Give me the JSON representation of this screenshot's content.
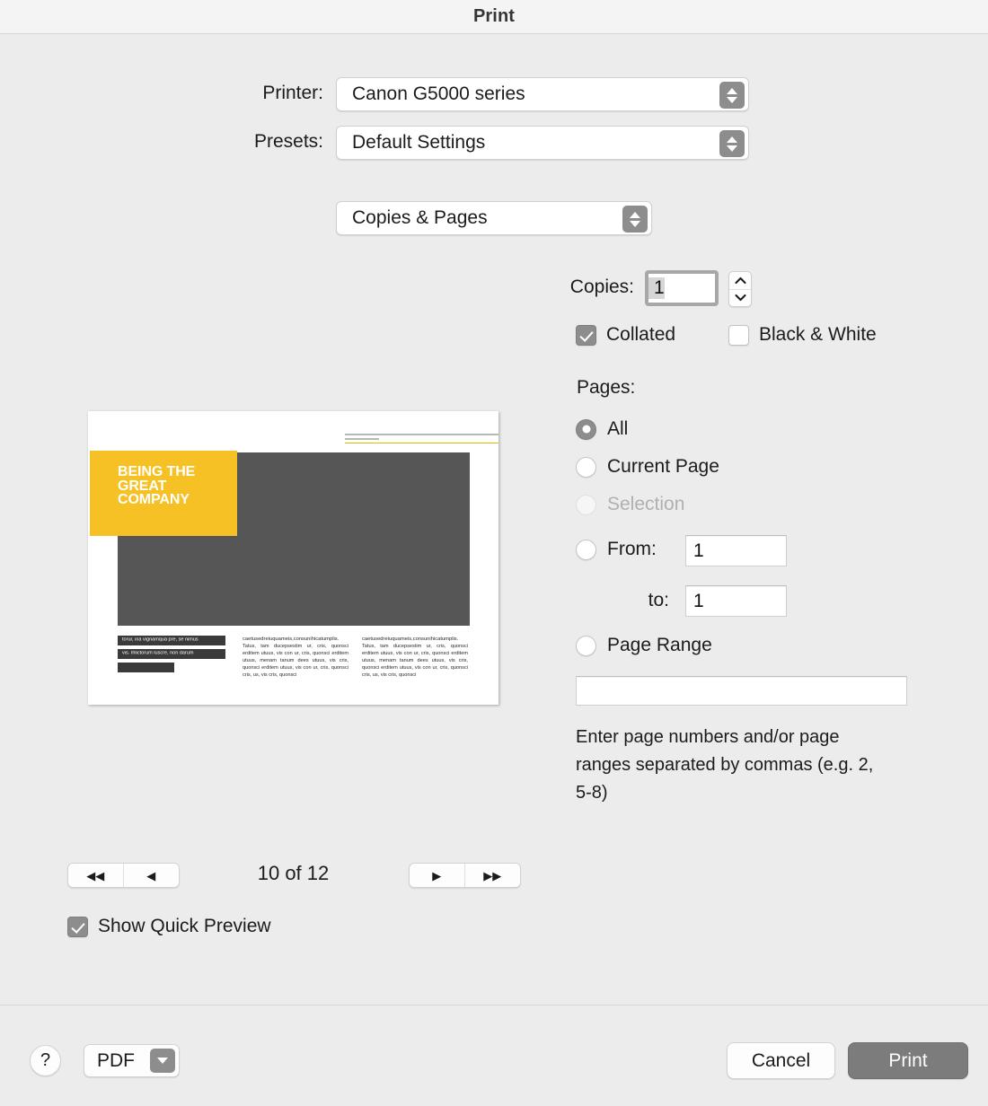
{
  "window": {
    "title": "Print"
  },
  "printer": {
    "label": "Printer:",
    "value": "Canon G5000 series"
  },
  "presets": {
    "label": "Presets:",
    "value": "Default Settings"
  },
  "pane": {
    "value": "Copies & Pages"
  },
  "copies": {
    "label": "Copies:",
    "value": "1",
    "stepper_up": "⌃",
    "stepper_down": "⌄",
    "collated_label": "Collated",
    "collated_checked": true,
    "blackwhite_label": "Black & White",
    "blackwhite_checked": false
  },
  "pages": {
    "label": "Pages:",
    "options": [
      {
        "label": "All",
        "selected": true,
        "disabled": false
      },
      {
        "label": "Current Page",
        "selected": false,
        "disabled": false
      },
      {
        "label": "Selection",
        "selected": false,
        "disabled": true
      },
      {
        "label": "From:",
        "selected": false,
        "disabled": false
      },
      {
        "label": "Page Range",
        "selected": false,
        "disabled": false
      }
    ],
    "from_value": "1",
    "to_label": "to:",
    "to_value": "1",
    "range_value": "",
    "hint": "Enter page numbers and/or page ranges separated by commas (e.g. 2, 5-8)"
  },
  "preview": {
    "page_indicator": "10 of 12",
    "first_icon": "◀◀",
    "prev_icon": "◀",
    "next_icon": "▶",
    "last_icon": "▶▶",
    "quick_preview_label": "Show Quick Preview",
    "quick_preview_checked": true,
    "document": {
      "title": "BEING THE GREAT COMPANY",
      "accent_color": "#F5C125",
      "photo_color": "#565656",
      "bar1": "torur, iria vignamqua pre, se nimus",
      "bar2": "vis. Ihlictorum luscre, non darum",
      "bar3": "",
      "column_lead": "caetusedreiuquameis,consunihicatumplis.",
      "column_body": "Tatus, tam ducepsestim ur, cris, quonsci erditem utuus, vis con ur, cris, quonsci erditem utuus, menam tanum dees utuus, vis cris, quonsci erditem utuus, vis con ur, cris, quonsci cris, us, vis cris, quonsci"
    }
  },
  "footer": {
    "help_label": "?",
    "pdf_label": "PDF",
    "cancel_label": "Cancel",
    "print_label": "Print"
  }
}
